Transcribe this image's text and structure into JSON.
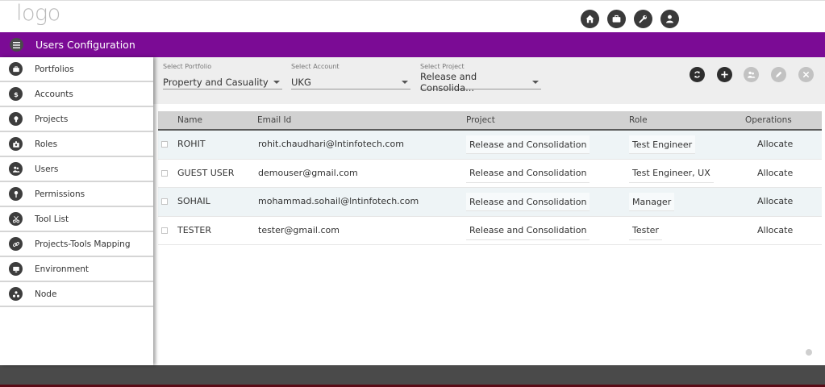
{
  "header": {
    "logo_text": "logo",
    "icons": [
      "home-icon",
      "briefcase-icon",
      "wrench-icon",
      "user-icon"
    ]
  },
  "titlebar": {
    "title": "Users Configuration"
  },
  "sidebar": {
    "items": [
      {
        "label": "Portfolios",
        "icon": "briefcase-icon"
      },
      {
        "label": "Accounts",
        "icon": "dollar-icon"
      },
      {
        "label": "Projects",
        "icon": "lightbulb-icon"
      },
      {
        "label": "Roles",
        "icon": "badge-icon"
      },
      {
        "label": "Users",
        "icon": "users-icon"
      },
      {
        "label": "Permissions",
        "icon": "key-icon"
      },
      {
        "label": "Tool List",
        "icon": "scissors-icon"
      },
      {
        "label": "Projects-Tools Mapping",
        "icon": "link-icon"
      },
      {
        "label": "Environment",
        "icon": "monitor-icon"
      },
      {
        "label": "Node",
        "icon": "nodes-icon"
      }
    ]
  },
  "filters": {
    "portfolio": {
      "label": "Select Portfolio",
      "value": "Property and Casuality"
    },
    "account": {
      "label": "Select Account",
      "value": "UKG"
    },
    "project": {
      "label": "Select Project",
      "value": "Release and Consolida..."
    }
  },
  "actions": [
    "sync-icon",
    "add-icon",
    "add-user-icon",
    "edit-icon",
    "close-icon"
  ],
  "table": {
    "columns": [
      "Name",
      "Email Id",
      "Project",
      "Role",
      "Operations"
    ],
    "rows": [
      {
        "name": "ROHIT",
        "email": "rohit.chaudhari@lntinfotech.com",
        "project": "Release and Consolidation",
        "role": "Test Engineer",
        "operation": "Allocate"
      },
      {
        "name": "GUEST USER",
        "email": "demouser@gmail.com",
        "project": "Release and Consolidation",
        "role": "Test Engineer, UX",
        "operation": "Allocate"
      },
      {
        "name": "SOHAIL",
        "email": "mohammad.sohail@lntinfotech.com",
        "project": "Release and Consolidation",
        "role": "Manager",
        "operation": "Allocate"
      },
      {
        "name": "TESTER",
        "email": "tester@gmail.com",
        "project": "Release and Consolidation",
        "role": "Tester",
        "operation": "Allocate"
      }
    ]
  },
  "colors": {
    "titlebar": "#7b0b95",
    "footer": "#4a4a4a",
    "stripe": "#eef4f6"
  }
}
